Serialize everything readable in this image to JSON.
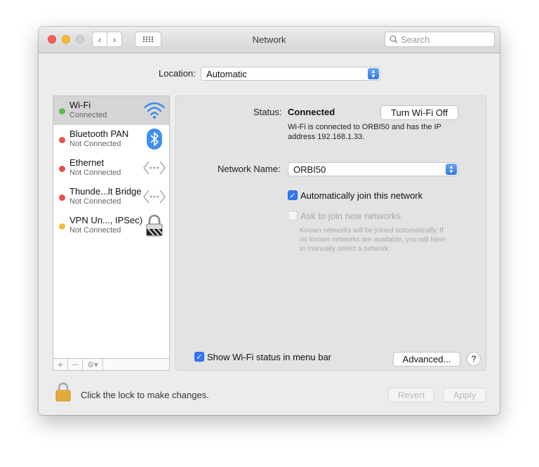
{
  "window": {
    "title": "Network",
    "search_placeholder": "Search",
    "nav_back": "‹",
    "nav_forward": "›"
  },
  "location": {
    "label": "Location:",
    "value": "Automatic"
  },
  "services": [
    {
      "name": "Wi-Fi",
      "status": "Connected",
      "dot_color": "#5cbf4c",
      "icon": "wifi-icon"
    },
    {
      "name": "Bluetooth PAN",
      "status": "Not Connected",
      "dot_color": "#e4524a",
      "icon": "bluetooth-icon"
    },
    {
      "name": "Ethernet",
      "status": "Not Connected",
      "dot_color": "#e4524a",
      "icon": "ethernet-icon"
    },
    {
      "name": "Thunde...lt Bridge",
      "status": "Not Connected",
      "dot_color": "#e4524a",
      "icon": "thunderbolt-bridge-icon"
    },
    {
      "name": "VPN Un..., IPSec)",
      "status": "Not Connected",
      "dot_color": "#f2bd38",
      "icon": "vpn-lock-icon"
    }
  ],
  "sidebar_toolbar": {
    "add": "+",
    "remove": "—",
    "gear": "⚙▾"
  },
  "detail": {
    "status_label": "Status:",
    "status_value": "Connected",
    "turn_off_button": "Turn Wi-Fi Off",
    "status_desc_line1": "Wi-Fi is connected to ORBI50 and has the IP",
    "status_desc_line2": "address 192.168.1.33.",
    "network_name_label": "Network Name:",
    "network_name_value": "ORBI50",
    "auto_join_label": "Automatically join this network",
    "auto_join_checked": true,
    "ask_join_label": "Ask to join new networks",
    "ask_join_checked": false,
    "ask_join_desc_line1": "Known networks will be joined automatically. If",
    "ask_join_desc_line2": "no known networks are available, you will have",
    "ask_join_desc_line3": "to manually select a network.",
    "show_status_label": "Show Wi-Fi status in menu bar",
    "show_status_checked": true,
    "advanced_button": "Advanced...",
    "help_button": "?"
  },
  "footer": {
    "lock_text": "Click the lock to make changes.",
    "revert_button": "Revert",
    "apply_button": "Apply"
  },
  "colors": {
    "accent": "#3478f6",
    "connected": "#5cbf4c",
    "not_connected": "#e4524a",
    "vpn": "#f2bd38"
  }
}
